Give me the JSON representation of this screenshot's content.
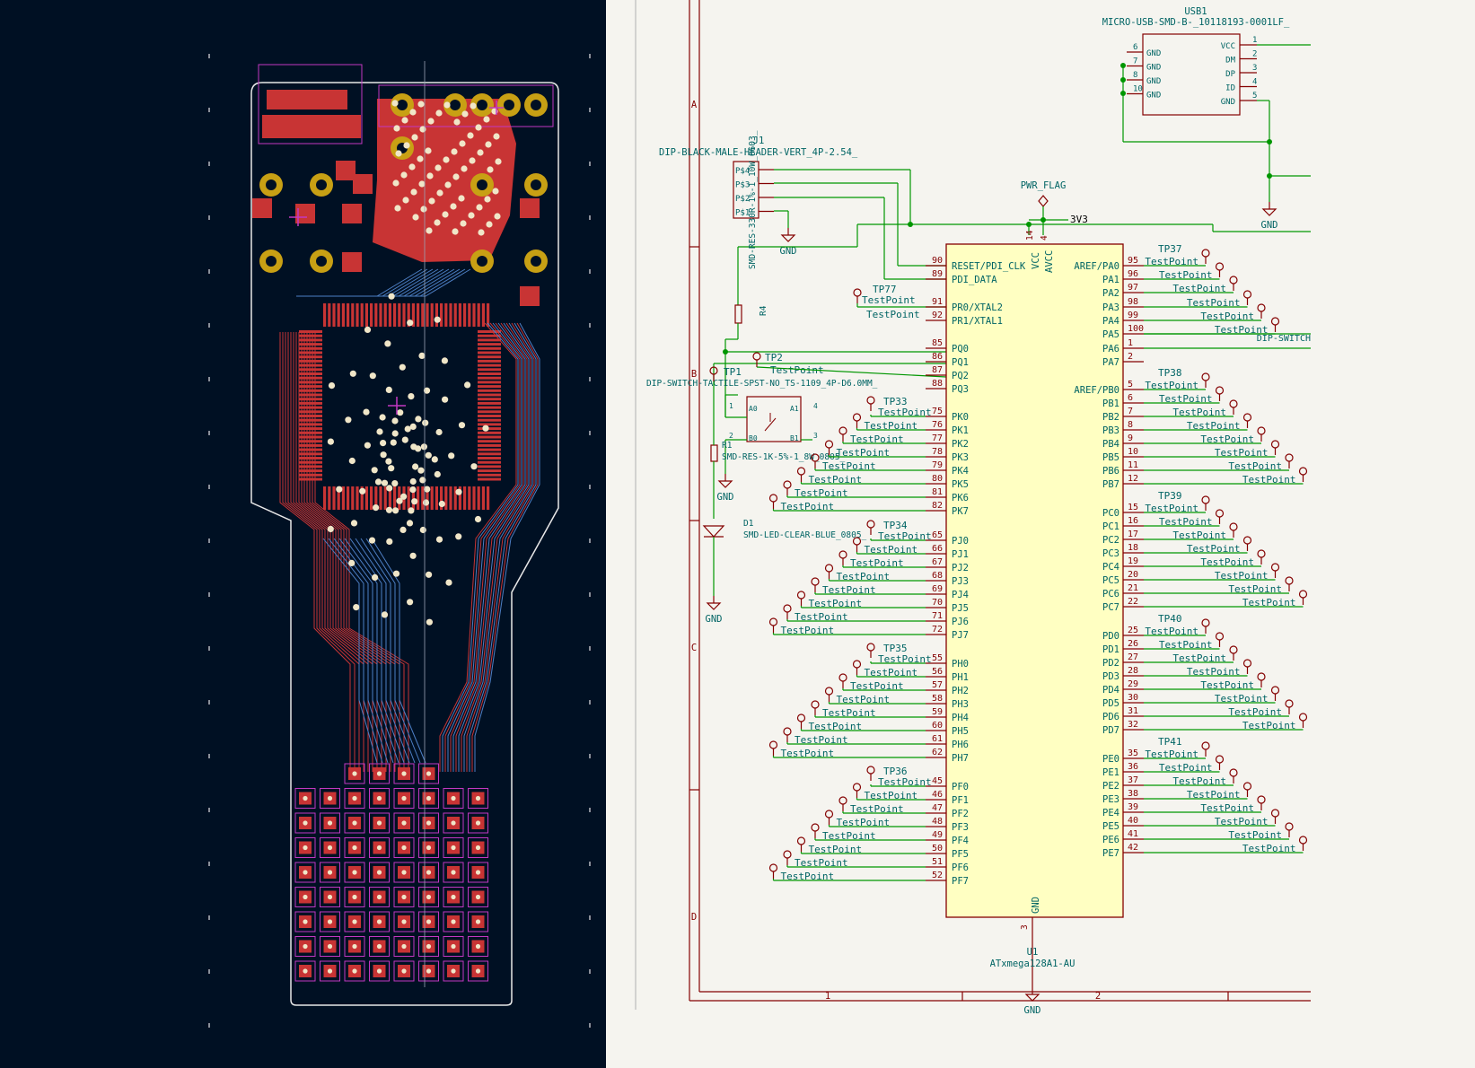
{
  "colors": {
    "pcb_bg": "#001023",
    "copper_front": "#c83434",
    "copper_back": "#4d7fc4",
    "pad_gold": "#c8a014",
    "silk": "#f2eda1",
    "courtyard": "#c238c2",
    "sch_bg": "#f5f4ef",
    "wire": "#009600",
    "pin": "#840000",
    "sym_fill": "#ffffc2",
    "text": "#006464",
    "border": "#840000"
  },
  "schematic": {
    "frame": {
      "rows": [
        "A",
        "B",
        "C",
        "D"
      ],
      "cols": [
        "1",
        "2"
      ]
    },
    "usb": {
      "ref": "USB1",
      "value": "MICRO-USB-SMD-B-_10118193-0001LF_",
      "left_pins": [
        {
          "num": "6",
          "name": "GND"
        },
        {
          "num": "7",
          "name": "GND"
        },
        {
          "num": "8",
          "name": "GND"
        },
        {
          "num": "10",
          "name": "GND"
        }
      ],
      "right_pins": [
        {
          "num": "1",
          "name": "VCC"
        },
        {
          "num": "2",
          "name": "DM"
        },
        {
          "num": "3",
          "name": "DP"
        },
        {
          "num": "4",
          "name": "ID"
        },
        {
          "num": "5",
          "name": "GND"
        }
      ],
      "gnd": "GND"
    },
    "j1": {
      "ref": "J1",
      "value": "DIP-BLACK-MALE-HEADER-VERT_4P-2.54_",
      "pins": [
        "P$4",
        "P$3",
        "P$2",
        "P$1"
      ],
      "gnd": "GND"
    },
    "pwr_flag": "PWR_FLAG",
    "net_3v3": "3V3",
    "r4": {
      "ref": "R4",
      "value": "SMD-RES-330R-1%-1_10W_0603_"
    },
    "r1": {
      "ref": "R1",
      "value": "SMD-RES-1K-5%-1_8W_0805_"
    },
    "sw": {
      "value": "DIP-SWITCH-TACTILE-SPST-NO_TS-1109_4P-D6.0MM_",
      "pins": [
        "1",
        "A0",
        "A1",
        "4",
        "2",
        "B0",
        "B1",
        "3"
      ],
      "gnd": "GND"
    },
    "d1": {
      "ref": "D1",
      "value": "SMD-LED-CLEAR-BLUE_0805_",
      "gnd": "GND"
    },
    "tp_single": [
      {
        "ref": "TP77",
        "value": "TestPoint"
      },
      {
        "ref": "TP2",
        "value": "TestPoint"
      },
      {
        "ref": "TP1",
        "value": "TestPoint"
      }
    ],
    "u1": {
      "ref": "U1",
      "value": "ATxmega128A1-AU",
      "top_pins": [
        {
          "num": "14",
          "name": "VCC"
        },
        {
          "num": "4",
          "name": "AVCC"
        }
      ],
      "bottom_pin": {
        "num": "3",
        "name": "GND"
      },
      "gnd": "GND",
      "left_pins": [
        {
          "num": "90",
          "name": "RESET/PDI_CLK"
        },
        {
          "num": "89",
          "name": "PDI_DATA"
        },
        {
          "num": "91",
          "name": "PR0/XTAL2"
        },
        {
          "num": "92",
          "name": "PR1/XTAL1"
        },
        {
          "num": "85",
          "name": "PQ0"
        },
        {
          "num": "86",
          "name": "PQ1"
        },
        {
          "num": "87",
          "name": "PQ2"
        },
        {
          "num": "88",
          "name": "PQ3"
        },
        {
          "num": "75",
          "name": "PK0"
        },
        {
          "num": "76",
          "name": "PK1"
        },
        {
          "num": "77",
          "name": "PK2"
        },
        {
          "num": "78",
          "name": "PK3"
        },
        {
          "num": "79",
          "name": "PK4"
        },
        {
          "num": "80",
          "name": "PK5"
        },
        {
          "num": "81",
          "name": "PK6"
        },
        {
          "num": "82",
          "name": "PK7"
        },
        {
          "num": "65",
          "name": "PJ0"
        },
        {
          "num": "66",
          "name": "PJ1"
        },
        {
          "num": "67",
          "name": "PJ2"
        },
        {
          "num": "68",
          "name": "PJ3"
        },
        {
          "num": "69",
          "name": "PJ4"
        },
        {
          "num": "70",
          "name": "PJ5"
        },
        {
          "num": "71",
          "name": "PJ6"
        },
        {
          "num": "72",
          "name": "PJ7"
        },
        {
          "num": "55",
          "name": "PH0"
        },
        {
          "num": "56",
          "name": "PH1"
        },
        {
          "num": "57",
          "name": "PH2"
        },
        {
          "num": "58",
          "name": "PH3"
        },
        {
          "num": "59",
          "name": "PH4"
        },
        {
          "num": "60",
          "name": "PH5"
        },
        {
          "num": "61",
          "name": "PH6"
        },
        {
          "num": "62",
          "name": "PH7"
        },
        {
          "num": "45",
          "name": "PF0"
        },
        {
          "num": "46",
          "name": "PF1"
        },
        {
          "num": "47",
          "name": "PF2"
        },
        {
          "num": "48",
          "name": "PF3"
        },
        {
          "num": "49",
          "name": "PF4"
        },
        {
          "num": "50",
          "name": "PF5"
        },
        {
          "num": "51",
          "name": "PF6"
        },
        {
          "num": "52",
          "name": "PF7"
        }
      ],
      "right_pins": [
        {
          "num": "95",
          "name": "AREF/PA0"
        },
        {
          "num": "96",
          "name": "PA1"
        },
        {
          "num": "97",
          "name": "PA2"
        },
        {
          "num": "98",
          "name": "PA3"
        },
        {
          "num": "99",
          "name": "PA4"
        },
        {
          "num": "100",
          "name": "PA5"
        },
        {
          "num": "1",
          "name": "PA6"
        },
        {
          "num": "2",
          "name": "PA7"
        },
        {
          "num": "5",
          "name": "AREF/PB0"
        },
        {
          "num": "6",
          "name": "PB1"
        },
        {
          "num": "7",
          "name": "PB2"
        },
        {
          "num": "8",
          "name": "PB3"
        },
        {
          "num": "9",
          "name": "PB4"
        },
        {
          "num": "10",
          "name": "PB5"
        },
        {
          "num": "11",
          "name": "PB6"
        },
        {
          "num": "12",
          "name": "PB7"
        },
        {
          "num": "15",
          "name": "PC0"
        },
        {
          "num": "16",
          "name": "PC1"
        },
        {
          "num": "17",
          "name": "PC2"
        },
        {
          "num": "18",
          "name": "PC3"
        },
        {
          "num": "19",
          "name": "PC4"
        },
        {
          "num": "20",
          "name": "PC5"
        },
        {
          "num": "21",
          "name": "PC6"
        },
        {
          "num": "22",
          "name": "PC7"
        },
        {
          "num": "25",
          "name": "PD0"
        },
        {
          "num": "26",
          "name": "PD1"
        },
        {
          "num": "27",
          "name": "PD2"
        },
        {
          "num": "28",
          "name": "PD3"
        },
        {
          "num": "29",
          "name": "PD4"
        },
        {
          "num": "30",
          "name": "PD5"
        },
        {
          "num": "31",
          "name": "PD6"
        },
        {
          "num": "32",
          "name": "PD7"
        },
        {
          "num": "35",
          "name": "PE0"
        },
        {
          "num": "36",
          "name": "PE1"
        },
        {
          "num": "37",
          "name": "PE2"
        },
        {
          "num": "38",
          "name": "PE3"
        },
        {
          "num": "39",
          "name": "PE4"
        },
        {
          "num": "40",
          "name": "PE5"
        },
        {
          "num": "41",
          "name": "PE6"
        },
        {
          "num": "42",
          "name": "PE7"
        }
      ]
    },
    "testpoint_label": "TestPoint",
    "left_group_refs": [
      "TP33",
      "TP34",
      "TP35",
      "TP36"
    ],
    "right_group_refs": [
      "TP37",
      "TP38",
      "TP39",
      "TP40",
      "TP41"
    ],
    "dip_switch_label": "DIP-SWITCH"
  }
}
